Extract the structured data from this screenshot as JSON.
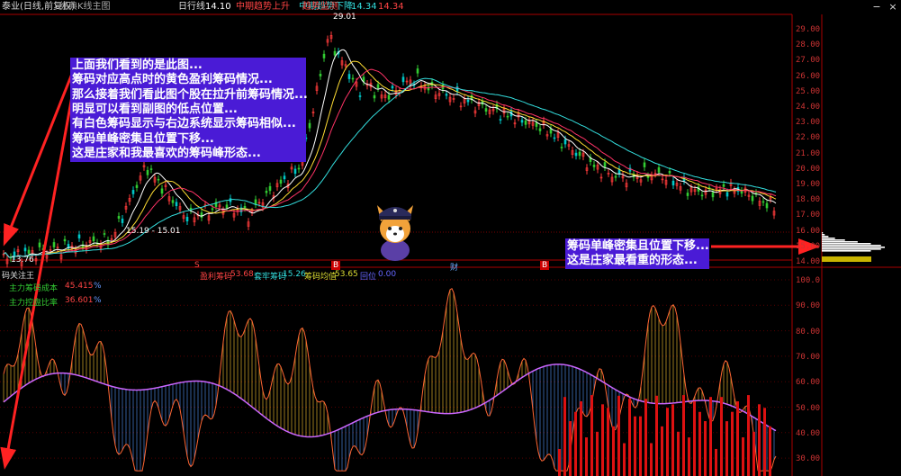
{
  "header": {
    "stock_label": "泰业(日线,前复权)",
    "template_label": "经典K线主图",
    "ma_label": "日行线",
    "ma_value": "14.10",
    "up_trend_label": "中期趋势上升",
    "down_trend_label": "中期趋势下降",
    "down_trend_value": "14.34",
    "support_label": "趋势监测",
    "support_value": "14.34",
    "btn_minus": "−",
    "btn_close": "×"
  },
  "price_axis": {
    "ticks": [
      "29.00",
      "28.00",
      "27.00",
      "26.00",
      "25.00",
      "24.00",
      "23.00",
      "22.00",
      "21.00",
      "20.00",
      "19.00",
      "18.00",
      "17.00",
      "16.00",
      "15.00",
      "14.00"
    ]
  },
  "chip_axis": {
    "ticks": [
      "100.0",
      "90.00",
      "80.00",
      "70.00",
      "60.00",
      "50.00",
      "40.00",
      "30.00"
    ]
  },
  "price_labels": {
    "high": "29.01",
    "low": "13.76",
    "mid": "15.19 - 15.01"
  },
  "markers": {
    "m1": "S",
    "m2": "B",
    "m3": "财",
    "m4": "B",
    "m5": "B",
    "m6": "B"
  },
  "sub_panel": {
    "title": "码关注王",
    "profit_label": "盈利筹码",
    "profit_value": "53.68",
    "trapped_label": "套牢筹码",
    "trapped_value": "15.26",
    "avg_label": "筹码均值",
    "avg_value": "53.65",
    "extra_label": "回位",
    "extra_value": "0.00",
    "main_cost_label": "主力筹码成本",
    "main_cost_value": "45.415",
    "main_cost_unit": "%",
    "main_ratio_label": "主力控盘比率",
    "main_ratio_value": "36.601",
    "main_ratio_unit": "%"
  },
  "annotation_main": {
    "lines": [
      "上面我们看到的是此图...",
      "筹码对应高点时的黄色盈利筹码情况...",
      "那么接着我们看此图个股在拉升前筹码情况...",
      "明显可以看到副图的低点位置...",
      "有白色筹码显示与右边系统显示筹码相似...",
      "筹码单峰密集且位置下移...",
      "这是庄家和我最喜欢的筹码峰形态..."
    ]
  },
  "annotation_right": {
    "lines": [
      "筹码单峰密集且位置下移...",
      "这是庄家最看重的形态..."
    ]
  },
  "colors": {
    "up": "#ff3b3b",
    "down": "#00c8c8",
    "green_candle": "#33cc33",
    "annot_bg": "#4a1bd6",
    "axis": "#aa0000"
  }
}
